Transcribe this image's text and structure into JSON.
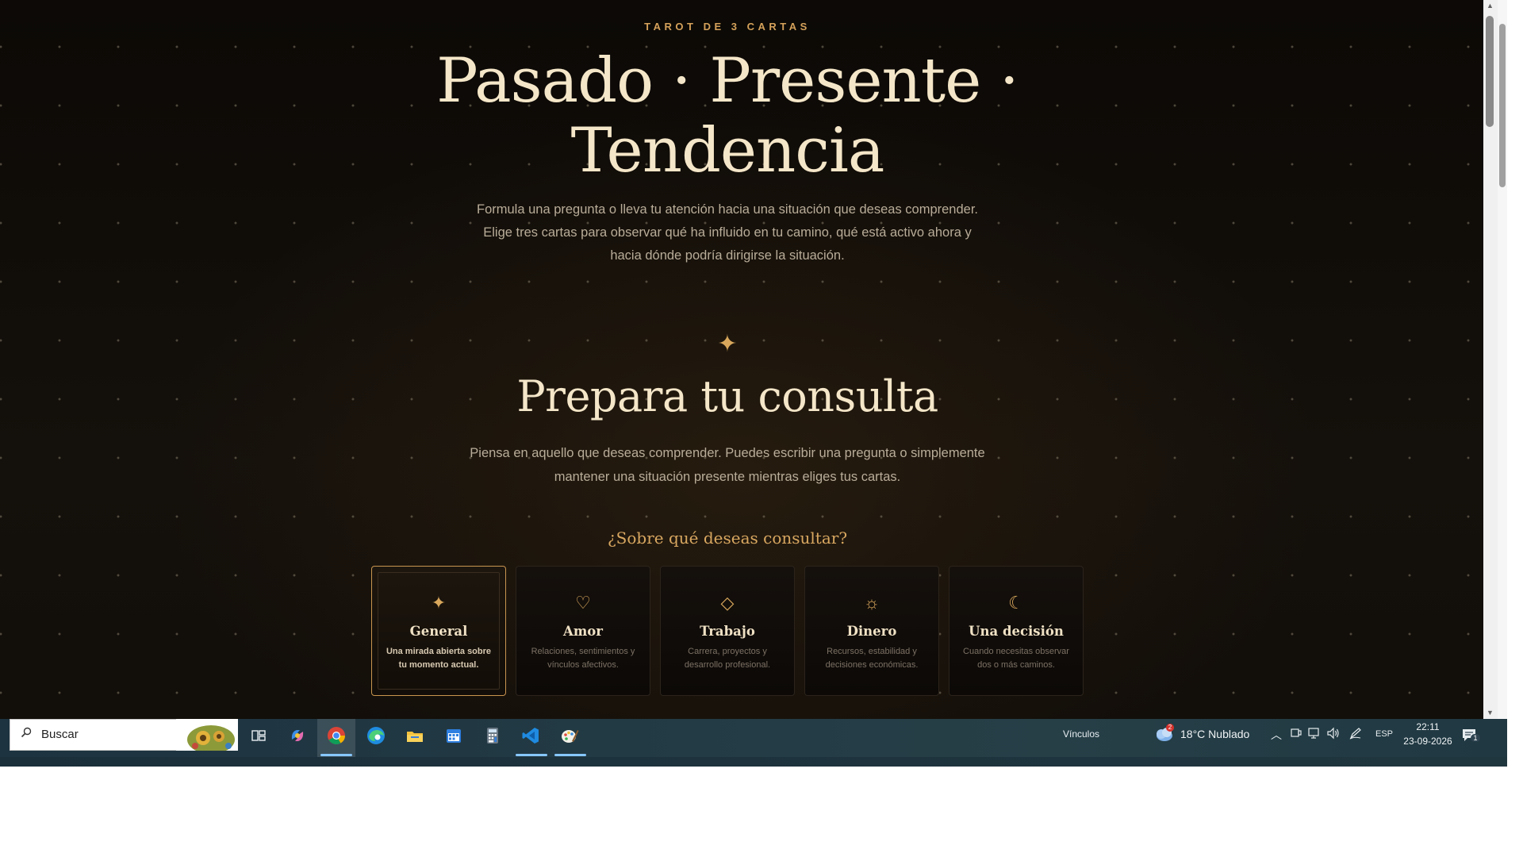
{
  "hero": {
    "eyebrow": "TAROT DE 3 CARTAS",
    "title_line1": "Pasado · Presente ·",
    "title_line2": "Tendencia",
    "description": "Formula una pregunta o lleva tu atención hacia una situación que deseas comprender. Elige tres cartas para observar qué ha influido en tu camino, qué está activo ahora y hacia dónde podría dirigirse la situación."
  },
  "section": {
    "divider_icon": "four-point-star-icon",
    "title": "Prepara tu consulta",
    "description": "Piensa en aquello que deseas comprender. Puedes escribir una pregunta o simplemente mantener una situación presente mientras eliges tus cartas.",
    "question": "¿Sobre qué deseas consultar?"
  },
  "categories": [
    {
      "key": "general",
      "icon": "four-point-star-icon",
      "glyph": "✦",
      "title": "General",
      "description": "Una mirada abierta sobre tu momento actual.",
      "selected": true
    },
    {
      "key": "amor",
      "icon": "heart-icon",
      "glyph": "♡",
      "title": "Amor",
      "description": "Relaciones, sentimientos y vínculos afectivos.",
      "selected": false
    },
    {
      "key": "trabajo",
      "icon": "diamond-icon",
      "glyph": "◇",
      "title": "Trabajo",
      "description": "Carrera, proyectos y desarrollo profesional.",
      "selected": false
    },
    {
      "key": "dinero",
      "icon": "sun-icon",
      "glyph": "☼",
      "title": "Dinero",
      "description": "Recursos, estabilidad y decisiones económicas.",
      "selected": false
    },
    {
      "key": "decision",
      "icon": "moon-icon",
      "glyph": "☾",
      "title": "Una decisión",
      "description": "Cuando necesitas observar dos o más caminos.",
      "selected": false
    }
  ],
  "taskbar": {
    "search_placeholder": "Buscar",
    "apps": [
      "task-view-icon",
      "copilot-icon",
      "chrome-icon",
      "edge-icon",
      "file-explorer-icon",
      "calendar-icon",
      "calculator-icon",
      "vscode-icon",
      "paint-icon"
    ],
    "links_label": "Vínculos",
    "weather": "18°C  Nublado",
    "weather_badge": "2",
    "language": "ESP",
    "time": "22:11",
    "date": "23-09-2026",
    "notifications": "1"
  },
  "colors": {
    "accent": "#d4a15a",
    "heading": "#f4e6c8",
    "background": "#0f0b08"
  }
}
